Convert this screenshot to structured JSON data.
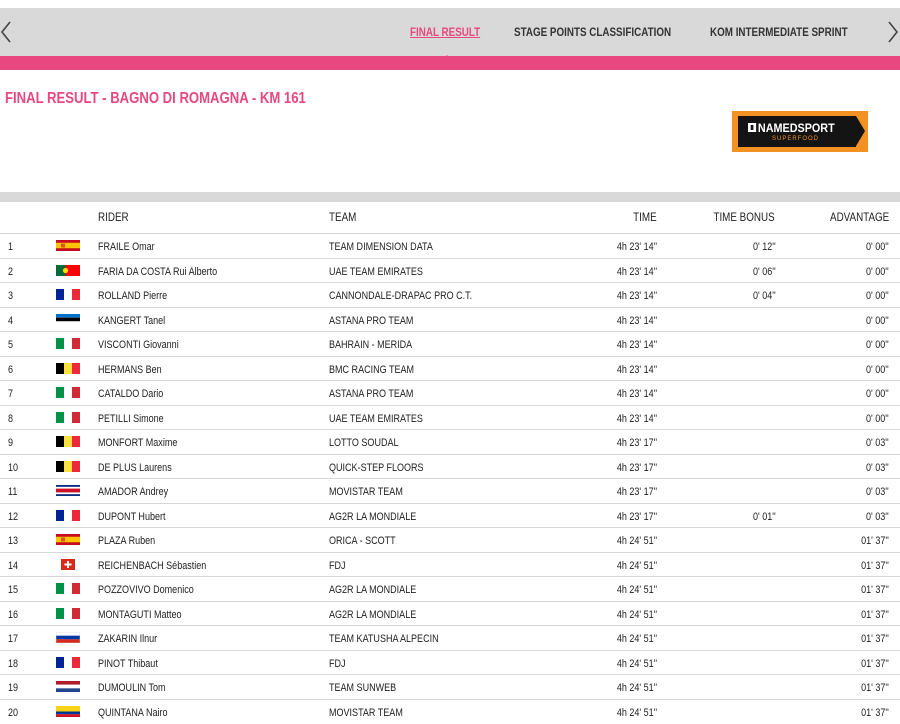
{
  "tabs": [
    {
      "label": "FINAL RESULT",
      "active": true
    },
    {
      "label": "STAGE POINTS CLASSIFICATION",
      "active": false
    },
    {
      "label": "KOM INTERMEDIATE SPRINT",
      "active": false
    }
  ],
  "nav": {
    "prev_icon": "chevron-left-icon",
    "next_icon": "chevron-right-icon"
  },
  "page_title": "FINAL RESULT - BAGNO DI ROMAGNA - KM 161",
  "sponsor": {
    "name": "NAMEDSPORT",
    "tagline": "SUPERFOOD",
    "icon": "namedsport-logo-mark"
  },
  "colors": {
    "accent": "#e8487f",
    "bar": "#d9d9d9",
    "sponsor_orange": "#f29222"
  },
  "table": {
    "headers": {
      "rider": "RIDER",
      "team": "TEAM",
      "time": "TIME",
      "bonus": "TIME BONUS",
      "advantage": "ADVANTAGE"
    },
    "rows": [
      {
        "pos": "1",
        "flag": "ES",
        "rider": "FRAILE Omar",
        "team": "TEAM DIMENSION DATA",
        "time": "4h 23' 14''",
        "bonus": "0' 12''",
        "adv": "0' 00''"
      },
      {
        "pos": "2",
        "flag": "PT",
        "rider": "FARIA DA COSTA Rui Alberto",
        "team": "UAE TEAM EMIRATES",
        "time": "4h 23' 14''",
        "bonus": "0' 06''",
        "adv": "0' 00''"
      },
      {
        "pos": "3",
        "flag": "FR",
        "rider": "ROLLAND Pierre",
        "team": "CANNONDALE-DRAPAC PRO C.T.",
        "time": "4h 23' 14''",
        "bonus": "0' 04''",
        "adv": "0' 00''"
      },
      {
        "pos": "4",
        "flag": "EE",
        "rider": "KANGERT Tanel",
        "team": "ASTANA PRO TEAM",
        "time": "4h 23' 14''",
        "bonus": "",
        "adv": "0' 00''"
      },
      {
        "pos": "5",
        "flag": "IT",
        "rider": "VISCONTI Giovanni",
        "team": "BAHRAIN - MERIDA",
        "time": "4h 23' 14''",
        "bonus": "",
        "adv": "0' 00''"
      },
      {
        "pos": "6",
        "flag": "BE",
        "rider": "HERMANS Ben",
        "team": "BMC RACING TEAM",
        "time": "4h 23' 14''",
        "bonus": "",
        "adv": "0' 00''"
      },
      {
        "pos": "7",
        "flag": "IT",
        "rider": "CATALDO Dario",
        "team": "ASTANA PRO TEAM",
        "time": "4h 23' 14''",
        "bonus": "",
        "adv": "0' 00''"
      },
      {
        "pos": "8",
        "flag": "IT",
        "rider": "PETILLI Simone",
        "team": "UAE TEAM EMIRATES",
        "time": "4h 23' 14''",
        "bonus": "",
        "adv": "0' 00''"
      },
      {
        "pos": "9",
        "flag": "BE",
        "rider": "MONFORT Maxime",
        "team": "LOTTO SOUDAL",
        "time": "4h 23' 17''",
        "bonus": "",
        "adv": "0' 03''"
      },
      {
        "pos": "10",
        "flag": "BE",
        "rider": "DE PLUS Laurens",
        "team": "QUICK-STEP FLOORS",
        "time": "4h 23' 17''",
        "bonus": "",
        "adv": "0' 03''"
      },
      {
        "pos": "11",
        "flag": "CR",
        "rider": "AMADOR Andrey",
        "team": "MOVISTAR TEAM",
        "time": "4h 23' 17''",
        "bonus": "",
        "adv": "0' 03''"
      },
      {
        "pos": "12",
        "flag": "FR",
        "rider": "DUPONT Hubert",
        "team": "AG2R LA MONDIALE",
        "time": "4h 23' 17''",
        "bonus": "0' 01''",
        "adv": "0' 03''"
      },
      {
        "pos": "13",
        "flag": "ES",
        "rider": "PLAZA Ruben",
        "team": "ORICA - SCOTT",
        "time": "4h 24' 51''",
        "bonus": "",
        "adv": "01' 37''"
      },
      {
        "pos": "14",
        "flag": "CH",
        "rider": "REICHENBACH Sébastien",
        "team": "FDJ",
        "time": "4h 24' 51''",
        "bonus": "",
        "adv": "01' 37''"
      },
      {
        "pos": "15",
        "flag": "IT",
        "rider": "POZZOVIVO Domenico",
        "team": "AG2R LA MONDIALE",
        "time": "4h 24' 51''",
        "bonus": "",
        "adv": "01' 37''"
      },
      {
        "pos": "16",
        "flag": "IT",
        "rider": "MONTAGUTI Matteo",
        "team": "AG2R LA MONDIALE",
        "time": "4h 24' 51''",
        "bonus": "",
        "adv": "01' 37''"
      },
      {
        "pos": "17",
        "flag": "RU",
        "rider": "ZAKARIN Ilnur",
        "team": "TEAM KATUSHA ALPECIN",
        "time": "4h 24' 51''",
        "bonus": "",
        "adv": "01' 37''"
      },
      {
        "pos": "18",
        "flag": "FR",
        "rider": "PINOT Thibaut",
        "team": "FDJ",
        "time": "4h 24' 51''",
        "bonus": "",
        "adv": "01' 37''"
      },
      {
        "pos": "19",
        "flag": "NL",
        "rider": "DUMOULIN Tom",
        "team": "TEAM SUNWEB",
        "time": "4h 24' 51''",
        "bonus": "",
        "adv": "01' 37''"
      },
      {
        "pos": "20",
        "flag": "CO",
        "rider": "QUINTANA Nairo",
        "team": "MOVISTAR TEAM",
        "time": "4h 24' 51''",
        "bonus": "",
        "adv": "01' 37''"
      }
    ]
  }
}
